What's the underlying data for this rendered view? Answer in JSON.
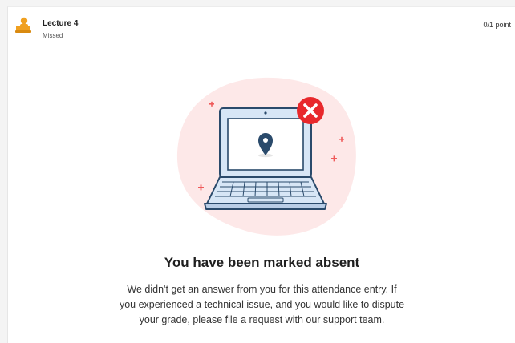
{
  "item": {
    "title": "Lecture 4",
    "status": "Missed",
    "points": "0/1 point",
    "icon": "attendance-person-icon"
  },
  "result": {
    "heading": "You have been marked absent",
    "message_lines": [
      "We didn't get an answer from you for this attendance entry. If",
      "you experienced a technical issue, and you would like to dispute",
      "your grade, please file a request with our support team."
    ],
    "illustration_icons": [
      "laptop-icon",
      "location-pin-icon",
      "error-x-icon",
      "sparkle-icon"
    ]
  },
  "colors": {
    "accent_orange": "#f0a020",
    "error_red": "#e8282c",
    "laptop_blue": "#d7e6f6",
    "outline_navy": "#2a4a6b",
    "blob_pink": "#fde8e8"
  }
}
